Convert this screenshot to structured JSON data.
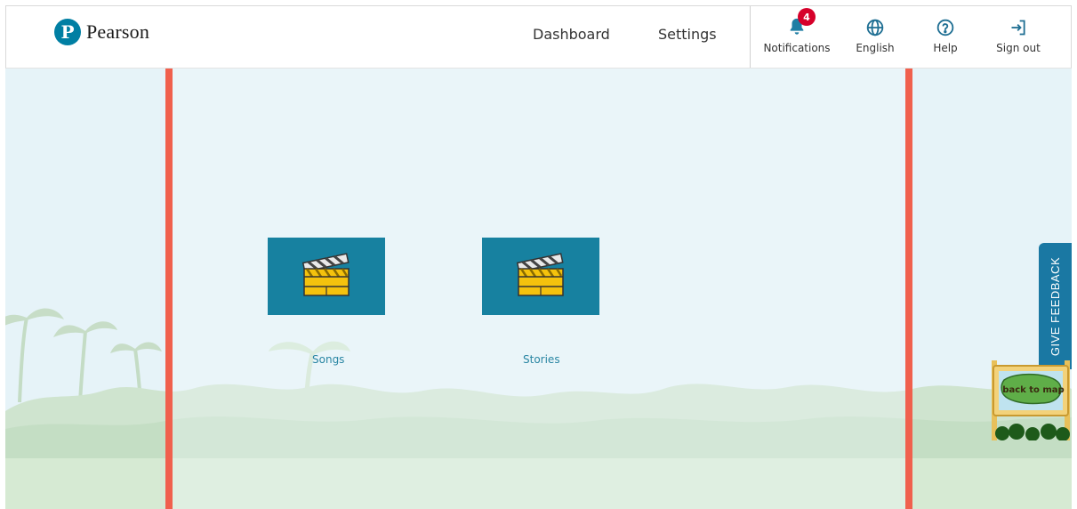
{
  "brand": {
    "name": "Pearson",
    "badge_letter": "P",
    "color": "#007fa3"
  },
  "nav": {
    "dashboard": "Dashboard",
    "settings": "Settings"
  },
  "utilities": {
    "notifications": {
      "label": "Notifications",
      "count": "4",
      "icon": "bell-icon"
    },
    "language": {
      "label": "English",
      "icon": "globe-icon"
    },
    "help": {
      "label": "Help",
      "icon": "question-circle-icon"
    },
    "signout": {
      "label": "Sign out",
      "icon": "sign-out-icon"
    }
  },
  "tiles": [
    {
      "label": "Songs",
      "icon": "clapperboard-icon"
    },
    {
      "label": "Stories",
      "icon": "clapperboard-icon"
    }
  ],
  "feedback": {
    "label": "GIVE FEEDBACK"
  },
  "map_sign": {
    "label": "back to map"
  },
  "colors": {
    "panel_border": "#f0604d",
    "tile": "#1781a0",
    "feedback": "#1a78a3",
    "badge": "#d6002a"
  }
}
